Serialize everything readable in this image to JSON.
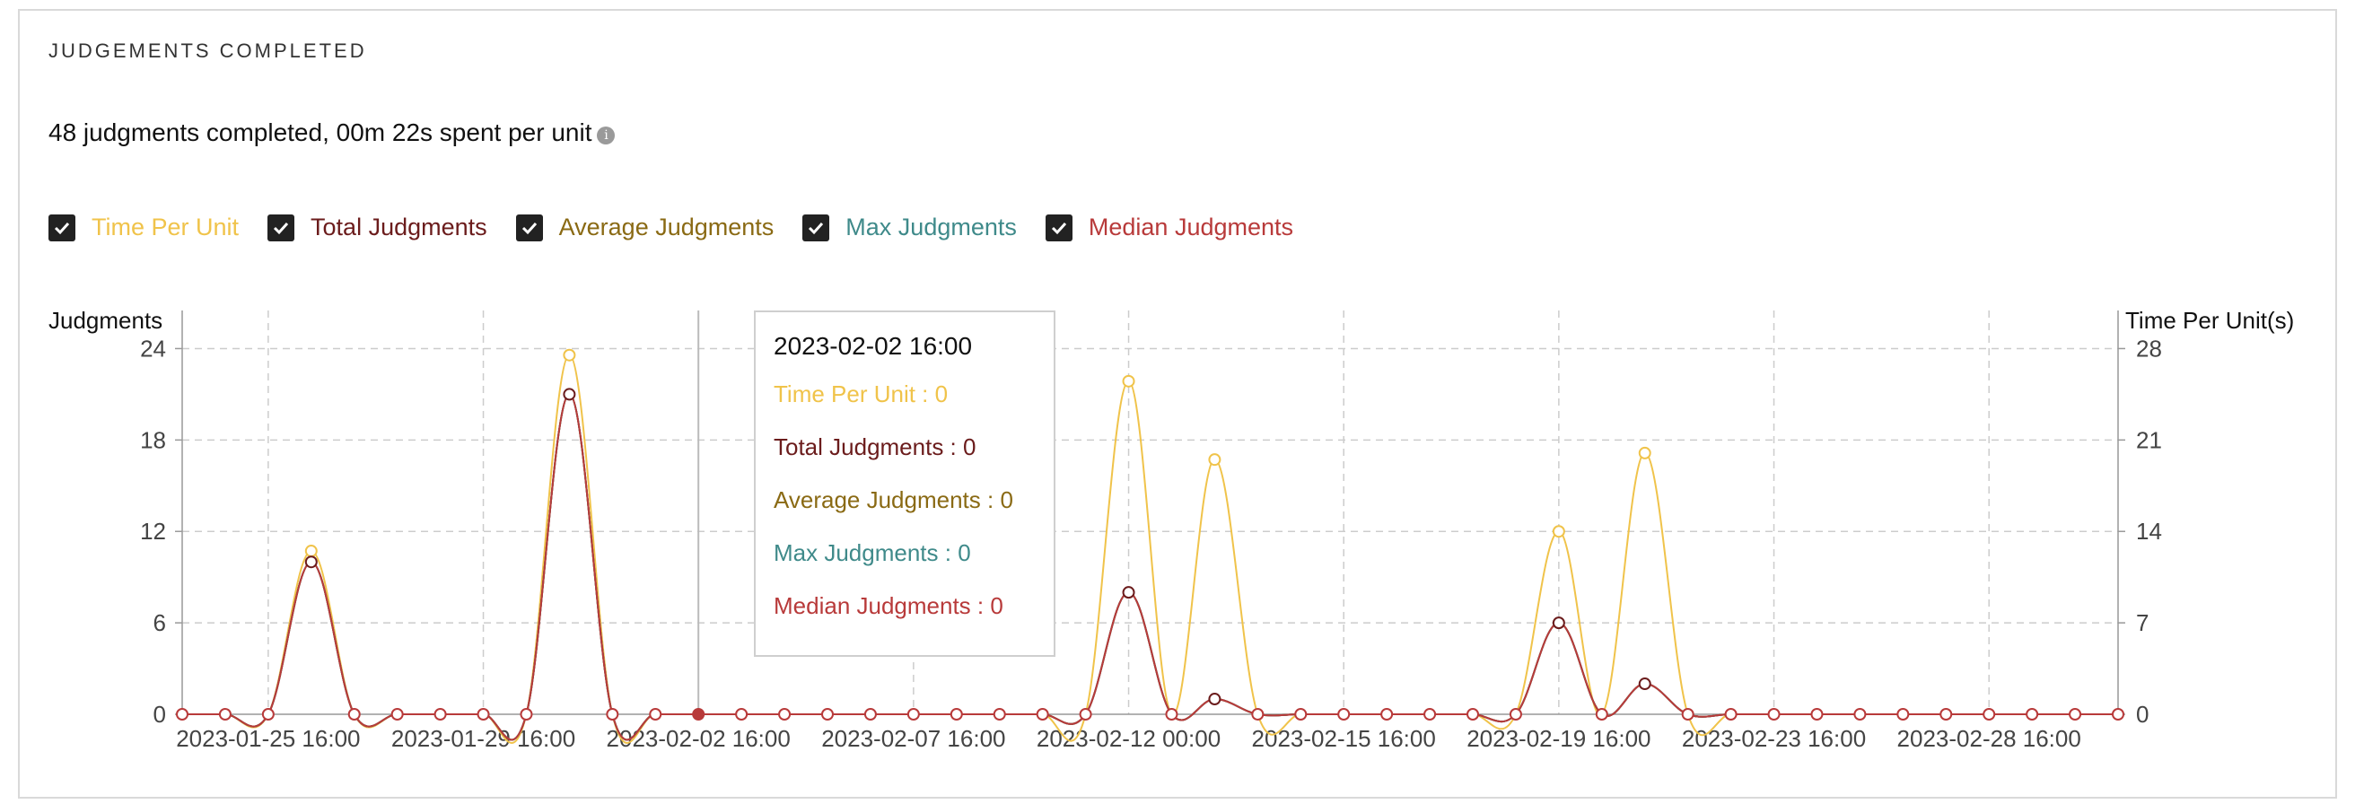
{
  "section_title": "JUDGEMENTS COMPLETED",
  "summary_text": "48 judgments completed, 00m 22s spent per unit",
  "info_icon": "info-icon",
  "colors": {
    "time_per_unit": "#f0c34a",
    "total_judgments": "#6b1c1c",
    "average_judgments": "#8a6a14",
    "max_judgments": "#3f8a8a",
    "median_judgments": "#b83a3a",
    "grid": "#cccccc",
    "axis": "#999999"
  },
  "legend": [
    {
      "label": "Time Per Unit",
      "checked": true,
      "color_key": "time_per_unit"
    },
    {
      "label": "Total Judgments",
      "checked": true,
      "color_key": "total_judgments"
    },
    {
      "label": "Average Judgments",
      "checked": true,
      "color_key": "average_judgments"
    },
    {
      "label": "Max Judgments",
      "checked": true,
      "color_key": "max_judgments"
    },
    {
      "label": "Median Judgments",
      "checked": true,
      "color_key": "median_judgments"
    }
  ],
  "tooltip": {
    "title": "2023-02-02 16:00",
    "rows": [
      {
        "text": "Time Per Unit : 0",
        "color_key": "time_per_unit"
      },
      {
        "text": "Total Judgments : 0",
        "color_key": "total_judgments"
      },
      {
        "text": "Average Judgments : 0",
        "color_key": "average_judgments"
      },
      {
        "text": "Max Judgments : 0",
        "color_key": "max_judgments"
      },
      {
        "text": "Median Judgments : 0",
        "color_key": "median_judgments"
      }
    ]
  },
  "chart_data": {
    "type": "line",
    "ylabel_left": "Judgments",
    "ylabel_right": "Time Per Unit(s)",
    "ylim_left": [
      0,
      24
    ],
    "yticks_left": [
      0,
      6,
      12,
      18,
      24
    ],
    "ylim_right": [
      0,
      28
    ],
    "yticks_right": [
      0,
      7,
      14,
      21,
      28
    ],
    "grid": true,
    "x_tick_labels": [
      "2023-01-25 16:00",
      "2023-01-29 16:00",
      "2023-02-02 16:00",
      "2023-02-07 16:00",
      "2023-02-12 00:00",
      "2023-02-15 16:00",
      "2023-02-19 16:00",
      "2023-02-23 16:00",
      "2023-02-28 16:00"
    ],
    "x_tick_index": [
      2,
      7,
      12,
      17,
      22,
      27,
      32,
      37,
      42
    ],
    "highlight_index": 12,
    "series": [
      {
        "name": "Time Per Unit",
        "axis": "right",
        "color_key": "time_per_unit",
        "values": [
          0,
          0,
          0,
          12.5,
          0,
          0,
          0,
          0,
          0,
          27.5,
          0,
          0,
          0,
          0,
          0,
          0,
          0,
          0,
          0,
          0,
          0,
          0,
          25.5,
          0,
          19.5,
          0,
          0,
          0,
          0,
          0,
          0,
          0,
          14,
          0,
          20,
          0,
          0,
          0,
          0,
          0,
          0,
          0,
          0,
          0,
          0,
          0
        ]
      },
      {
        "name": "Total Judgments",
        "axis": "left",
        "color_key": "total_judgments",
        "values": [
          0,
          0,
          0,
          10,
          0,
          0,
          0,
          0,
          0,
          21,
          0,
          0,
          0,
          0,
          0,
          0,
          0,
          0,
          0,
          0,
          0,
          0,
          8,
          0,
          1,
          0,
          0,
          0,
          0,
          0,
          0,
          0,
          6,
          0,
          2,
          0,
          0,
          0,
          0,
          0,
          0,
          0,
          0,
          0,
          0,
          0
        ]
      },
      {
        "name": "Average Judgments",
        "axis": "left",
        "color_key": "average_judgments",
        "values": [
          0,
          0,
          0,
          10,
          0,
          0,
          0,
          0,
          0,
          21,
          0,
          0,
          0,
          0,
          0,
          0,
          0,
          0,
          0,
          0,
          0,
          0,
          8,
          0,
          1,
          0,
          0,
          0,
          0,
          0,
          0,
          0,
          6,
          0,
          2,
          0,
          0,
          0,
          0,
          0,
          0,
          0,
          0,
          0,
          0,
          0
        ]
      },
      {
        "name": "Max Judgments",
        "axis": "left",
        "color_key": "max_judgments",
        "values": [
          0,
          0,
          0,
          10,
          0,
          0,
          0,
          0,
          0,
          21,
          0,
          0,
          0,
          0,
          0,
          0,
          0,
          0,
          0,
          0,
          0,
          0,
          8,
          0,
          1,
          0,
          0,
          0,
          0,
          0,
          0,
          0,
          6,
          0,
          2,
          0,
          0,
          0,
          0,
          0,
          0,
          0,
          0,
          0,
          0,
          0
        ]
      },
      {
        "name": "Median Judgments",
        "axis": "left",
        "color_key": "median_judgments",
        "values": [
          0,
          0,
          0,
          10,
          0,
          0,
          0,
          0,
          0,
          21,
          0,
          0,
          0,
          0,
          0,
          0,
          0,
          0,
          0,
          0,
          0,
          0,
          8,
          0,
          1,
          0,
          0,
          0,
          0,
          0,
          0,
          0,
          6,
          0,
          2,
          0,
          0,
          0,
          0,
          0,
          0,
          0,
          0,
          0,
          0,
          0
        ]
      }
    ]
  }
}
